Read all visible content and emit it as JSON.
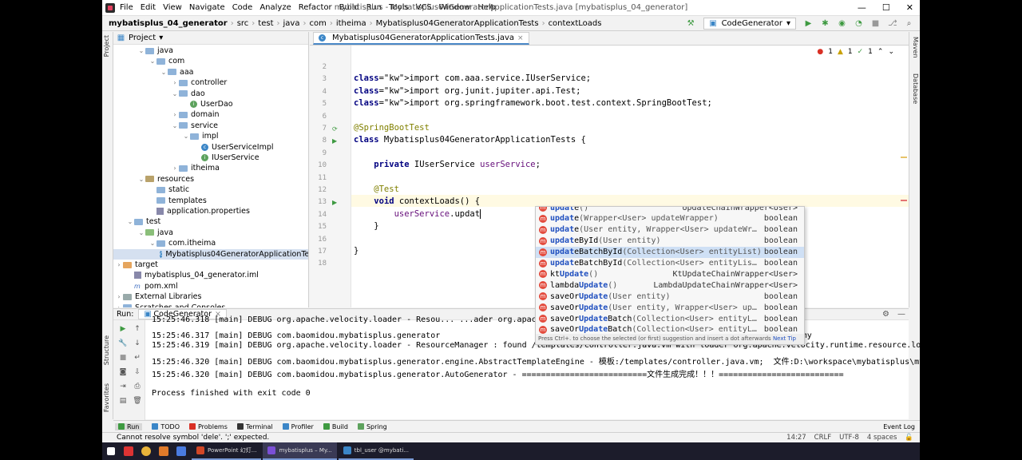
{
  "window": {
    "title": "mybatisplus - Mybatisplus04GeneratorApplicationTests.java [mybatisplus_04_generator]",
    "menu": [
      "File",
      "Edit",
      "View",
      "Navigate",
      "Code",
      "Analyze",
      "Refactor",
      "Build",
      "Run",
      "Tools",
      "VCS",
      "Window",
      "Help"
    ]
  },
  "breadcrumb": [
    "mybatisplus_04_generator",
    "src",
    "test",
    "java",
    "com",
    "itheima",
    "Mybatisplus04GeneratorApplicationTests",
    "contextLoads"
  ],
  "run_config": "CodeGenerator",
  "project_panel": {
    "title": "Project",
    "tree": [
      {
        "label": "java",
        "icon": "folder-blue",
        "open": true
      },
      {
        "label": "com",
        "icon": "folder",
        "open": true
      },
      {
        "label": "aaa",
        "icon": "folder",
        "open": true
      },
      {
        "label": "controller",
        "icon": "folder",
        "open": false
      },
      {
        "label": "dao",
        "icon": "folder",
        "open": true
      },
      {
        "label": "UserDao",
        "icon": "interface"
      },
      {
        "label": "domain",
        "icon": "folder",
        "open": false
      },
      {
        "label": "service",
        "icon": "folder",
        "open": true
      },
      {
        "label": "impl",
        "icon": "folder",
        "open": true
      },
      {
        "label": "UserServiceImpl",
        "icon": "class"
      },
      {
        "label": "IUserService",
        "icon": "interface"
      },
      {
        "label": "itheima",
        "icon": "folder",
        "open": false
      },
      {
        "label": "resources",
        "icon": "folder-res",
        "open": true
      },
      {
        "label": "static",
        "icon": "folder"
      },
      {
        "label": "templates",
        "icon": "folder"
      },
      {
        "label": "application.properties",
        "icon": "properties"
      },
      {
        "label": "test",
        "icon": "folder",
        "open": true
      },
      {
        "label": "java",
        "icon": "folder-green",
        "open": true
      },
      {
        "label": "com.itheima",
        "icon": "folder",
        "open": true
      },
      {
        "label": "Mybatisplus04GeneratorApplicationTe",
        "icon": "class",
        "selected": true
      },
      {
        "label": "target",
        "icon": "folder-orange",
        "open": false
      },
      {
        "label": "mybatisplus_04_generator.iml",
        "icon": "iml"
      },
      {
        "label": "pom.xml",
        "icon": "maven"
      },
      {
        "label": "External Libraries",
        "icon": "library",
        "open": false
      },
      {
        "label": "Scratches and Consoles",
        "icon": "scratch",
        "open": false
      }
    ]
  },
  "editor": {
    "tab": "Mybatisplus04GeneratorApplicationTests.java",
    "inspections": {
      "errors": "1",
      "warnings": "1",
      "ok": "1"
    },
    "lines": [
      {
        "n": "2",
        "text": ""
      },
      {
        "n": "3",
        "text": "import com.aaa.service.IUserService;"
      },
      {
        "n": "4",
        "text": "import org.junit.jupiter.api.Test;"
      },
      {
        "n": "5",
        "text": "import org.springframework.boot.test.context.SpringBootTest;"
      },
      {
        "n": "6",
        "text": ""
      },
      {
        "n": "7",
        "text": "@SpringBootTest"
      },
      {
        "n": "8",
        "text": "class Mybatisplus04GeneratorApplicationTests {"
      },
      {
        "n": "9",
        "text": ""
      },
      {
        "n": "10",
        "text": "    private IUserService userService;"
      },
      {
        "n": "11",
        "text": ""
      },
      {
        "n": "12",
        "text": "    @Test"
      },
      {
        "n": "13",
        "text": "    void contextLoads() {"
      },
      {
        "n": "14",
        "text": "        userService.updat"
      },
      {
        "n": "15",
        "text": "    }"
      },
      {
        "n": "16",
        "text": ""
      },
      {
        "n": "17",
        "text": "}"
      },
      {
        "n": "18",
        "text": ""
      }
    ]
  },
  "completion": {
    "items": [
      {
        "match": "updat",
        "rest": "e",
        "params": "()",
        "type": "UpdateChainWrapper<User>"
      },
      {
        "match": "updat",
        "rest": "e",
        "params": "(Wrapper<User> updateWrapper)",
        "type": "boolean"
      },
      {
        "match": "updat",
        "rest": "e",
        "params": "(User entity, Wrapper<User> updateWr…",
        "type": "boolean"
      },
      {
        "match": "updat",
        "rest": "eById",
        "params": "(User entity)",
        "type": "boolean"
      },
      {
        "match": "updat",
        "rest": "eBatchById",
        "params": "(Collection<User> entityList)",
        "type": "boolean",
        "selected": true
      },
      {
        "match": "updat",
        "rest": "eBatchById",
        "params": "(Collection<User> entityLis…",
        "type": "boolean"
      },
      {
        "match": "",
        "pre": "kt",
        "matchb": "Update",
        "rest": "",
        "params": "()",
        "type": "KtUpdateChainWrapper<User>"
      },
      {
        "match": "",
        "pre": "lambda",
        "matchb": "Update",
        "rest": "",
        "params": "()",
        "type": "LambdaUpdateChainWrapper<User>"
      },
      {
        "match": "",
        "pre": "saveOr",
        "matchb": "Update",
        "rest": "",
        "params": "(User entity)",
        "type": "boolean"
      },
      {
        "match": "",
        "pre": "saveOr",
        "matchb": "Update",
        "rest": "",
        "params": "(User entity, Wrapper<User> up…",
        "type": "boolean"
      },
      {
        "match": "",
        "pre": "saveOr",
        "matchb": "Update",
        "rest": "Batch",
        "params": "(Collection<User> entityL…",
        "type": "boolean"
      },
      {
        "match": "",
        "pre": "saveOr",
        "matchb": "Update",
        "rest": "Batch",
        "params": "(Collection<User> entityL…",
        "type": "boolean"
      }
    ],
    "hint": "Press Ctrl+. to choose the selected (or first) suggestion and insert a dot afterwards",
    "hint_link": "Next Tip"
  },
  "run_panel": {
    "label": "Run:",
    "tab": "CodeGenerator",
    "lines": [
      "15:25:46.318 [main] DEBUG org.apache.velocity.loader - Resou... ...ader org.apache.velocity.runtime.resource.loade",
      "15:25:46.317 [main] DEBUG com.baomidou.mybatisplus.generator                              ...pl.java.vm;  文件:D:\\workspace\\mybatisplus\\my",
      "15:25:46.319 [main] DEBUG org.apache.velocity.loader - ResourceManager : found /templates/controller.java.vm with loader org.apache.velocity.runtime.resource.loade",
      "15:25:46.320 [main] DEBUG com.baomidou.mybatisplus.generator.engine.AbstractTemplateEngine - 模板:/templates/controller.java.vm;  文件:D:\\workspace\\mybatisplus\\my",
      "15:25:46.320 [main] DEBUG com.baomidou.mybatisplus.generator.AutoGenerator - ==========================文件生成完成！！！=========================="
    ],
    "finish": "Process finished with exit code 0"
  },
  "bottom_tabs": [
    "Run",
    "TODO",
    "Problems",
    "Terminal",
    "Profiler",
    "Build",
    "Spring"
  ],
  "event_log": "Event Log",
  "status": {
    "message": "Cannot resolve symbol 'dele'. ';' expected.",
    "position": "14:27",
    "encoding": "UTF-8",
    "indent": "4 spaces"
  },
  "side_tabs": {
    "left": [
      "Project",
      "Structure",
      "Favorites"
    ],
    "right": [
      "Maven",
      "Database"
    ]
  },
  "taskbar": {
    "apps": [
      "PowerPoint 幻灯...",
      "mybatisplus – My...",
      "tbl_user @mybati..."
    ]
  }
}
